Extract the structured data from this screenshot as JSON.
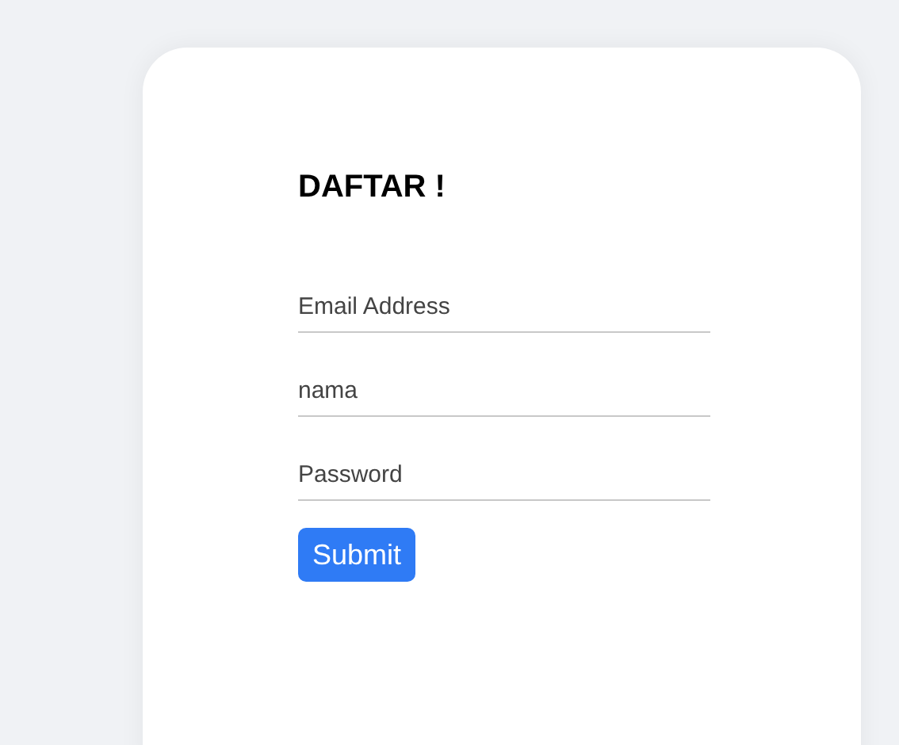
{
  "form": {
    "title": "DAFTAR !",
    "fields": [
      {
        "placeholder": "Email Address"
      },
      {
        "placeholder": "nama"
      },
      {
        "placeholder": "Password"
      }
    ],
    "submit": "Submit"
  }
}
